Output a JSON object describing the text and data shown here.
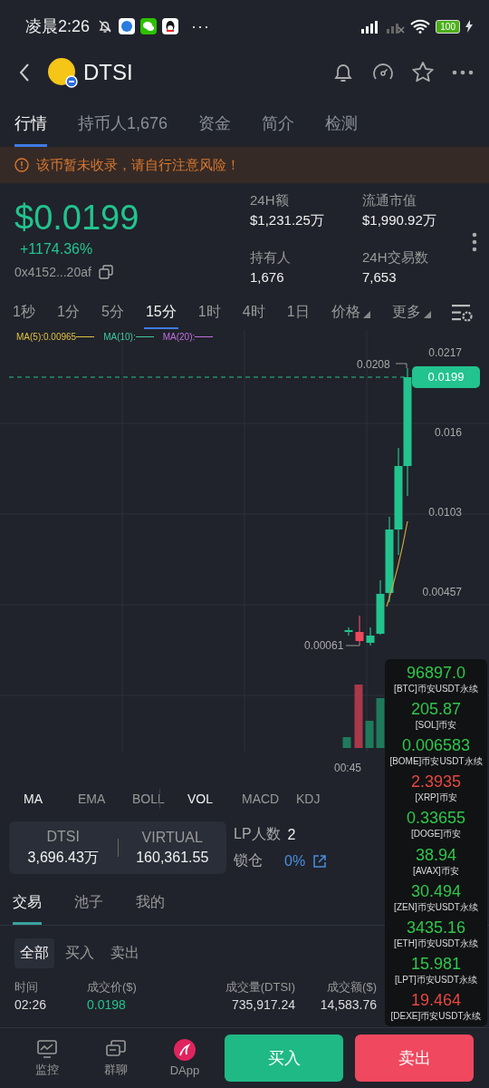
{
  "status_bar": {
    "time": "凌晨2:26",
    "dots": "···",
    "battery": "100"
  },
  "header": {
    "title": "DTSI"
  },
  "tabs": [
    {
      "label": "行情",
      "selected": true
    },
    {
      "label": "持币人1,676",
      "selected": false
    },
    {
      "label": "资金",
      "selected": false
    },
    {
      "label": "简介",
      "selected": false
    },
    {
      "label": "检测",
      "selected": false
    }
  ],
  "warning": "该币暂未收录，请自行注意风险！",
  "price": {
    "value": "$0.0199",
    "change": "+1174.36%",
    "address": "0x4152...20af"
  },
  "stats": [
    {
      "label": "24H额",
      "value": "$1,231.25万"
    },
    {
      "label": "流通市值",
      "value": "$1,990.92万"
    },
    {
      "label": "持有人",
      "value": "1,676"
    },
    {
      "label": "24H交易数",
      "value": "7,653"
    }
  ],
  "intervals": [
    {
      "label": "1秒",
      "selected": false
    },
    {
      "label": "1分",
      "selected": false
    },
    {
      "label": "5分",
      "selected": false
    },
    {
      "label": "15分",
      "selected": true
    },
    {
      "label": "1时",
      "selected": false
    },
    {
      "label": "4时",
      "selected": false
    },
    {
      "label": "1日",
      "selected": false
    },
    {
      "label": "价格",
      "selected": false,
      "dropdown": true
    },
    {
      "label": "更多",
      "selected": false,
      "dropdown": true
    }
  ],
  "chart": {
    "ma_legend": [
      {
        "label": "MA(5):0.00965",
        "color": "#e0c040"
      },
      {
        "label": "MA(10):",
        "color": "#3fc8a0"
      },
      {
        "label": "MA(20):",
        "color": "#c070e0"
      }
    ],
    "axis_labels": [
      "0.0217",
      "0.016",
      "0.0103",
      "0.00457"
    ],
    "high_label": "0.0208",
    "low_label": "0.00061",
    "last_price": "0.0199",
    "time_label": "00:45"
  },
  "indicators": [
    {
      "label": "MA",
      "selected": true
    },
    {
      "label": "EMA",
      "selected": false
    },
    {
      "label": "BOLL",
      "selected": false
    },
    {
      "label": "VOL",
      "selected": true
    },
    {
      "label": "MACD",
      "selected": false
    },
    {
      "label": "KDJ",
      "selected": false
    }
  ],
  "pool": {
    "tokens": [
      {
        "symbol": "DTSI",
        "amount": "3,696.43万"
      },
      {
        "symbol": "VIRTUAL",
        "amount": "160,361.55"
      }
    ],
    "lp_label": "LP人数",
    "lp_count": "2",
    "lock_label": "锁仓",
    "lock_value": "0%"
  },
  "section_tabs": [
    {
      "label": "交易",
      "selected": true
    },
    {
      "label": "池子",
      "selected": false
    },
    {
      "label": "我的",
      "selected": false
    }
  ],
  "filters": [
    {
      "label": "全部",
      "selected": true
    },
    {
      "label": "买入",
      "selected": false
    },
    {
      "label": "卖出",
      "selected": false
    }
  ],
  "trades": {
    "columns": [
      "时间",
      "成交价($)",
      "成交量(DTSI)",
      "成交额($)"
    ],
    "rows": [
      {
        "cells": [
          "02:26",
          "0.0198",
          "735,917.24",
          "14,583.76"
        ],
        "color": "#22c38e"
      }
    ]
  },
  "ticker": [
    {
      "value": "96897.0",
      "label": "[BTC]币安USDT永续",
      "color": "#2ec84a"
    },
    {
      "value": "205.87",
      "label": "[SOL]币安",
      "color": "#2ec84a"
    },
    {
      "value": "0.006583",
      "label": "[BOME]币安USDT永续",
      "color": "#2ec84a"
    },
    {
      "value": "2.3935",
      "label": "[XRP]币安",
      "color": "#e5483e"
    },
    {
      "value": "0.33655",
      "label": "[DOGE]币安",
      "color": "#2ec84a"
    },
    {
      "value": "38.94",
      "label": "[AVAX]币安",
      "color": "#2ec84a"
    },
    {
      "value": "30.494",
      "label": "[ZEN]币安USDT永续",
      "color": "#2ec84a"
    },
    {
      "value": "3435.16",
      "label": "[ETH]币安USDT永续",
      "color": "#2ec84a"
    },
    {
      "value": "15.981",
      "label": "[LPT]币安USDT永续",
      "color": "#2ec84a"
    },
    {
      "value": "19.464",
      "label": "[DEXE]币安USDT永续",
      "color": "#e5483e"
    }
  ],
  "bottom_bar": {
    "items": [
      {
        "label": "监控",
        "kind": "monitor"
      },
      {
        "label": "群聊",
        "kind": "chat"
      },
      {
        "label": "DApp",
        "kind": "dapp"
      }
    ],
    "buy": "买入",
    "sell": "卖出"
  }
}
